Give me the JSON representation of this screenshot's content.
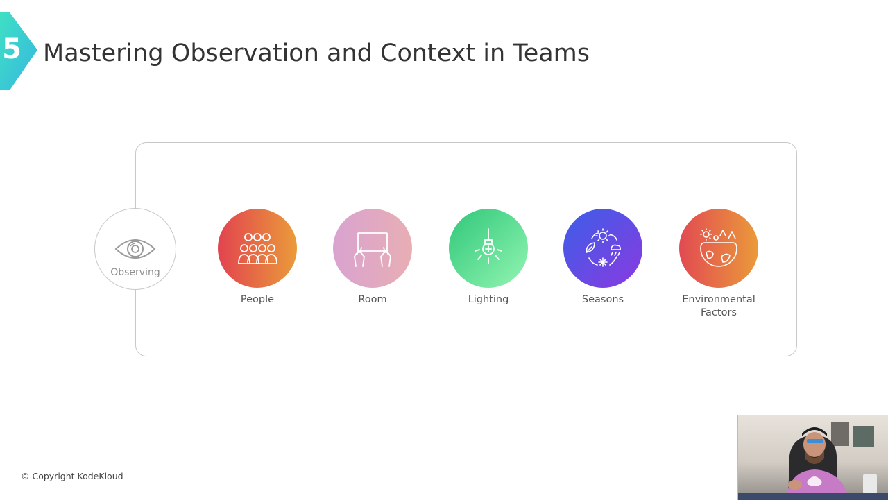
{
  "header": {
    "section_number": "5",
    "title": "Mastering Observation and Context in Teams",
    "accent_color": "#3fd7c7"
  },
  "diagram": {
    "observer": {
      "label": "Observing",
      "icon": "eye-icon"
    },
    "factors": [
      {
        "label": "People",
        "icon": "people-group-icon",
        "gradient": [
          "#e2434f",
          "#ea9b3a"
        ]
      },
      {
        "label": "Room",
        "icon": "room-hands-icon",
        "gradient": [
          "#d9a3d0",
          "#e8aeb4"
        ]
      },
      {
        "label": "Lighting",
        "icon": "light-bulb-icon",
        "gradient": [
          "#2fc77a",
          "#93f5b2"
        ]
      },
      {
        "label": "Seasons",
        "icon": "seasons-weather-icon",
        "gradient": [
          "#3c5ee8",
          "#8a3ae0"
        ]
      },
      {
        "label": "Environmental Factors",
        "icon": "earth-environment-icon",
        "gradient": [
          "#e24a52",
          "#ea9a3a"
        ]
      }
    ]
  },
  "footer": {
    "copyright": "© Copyright KodeKloud"
  }
}
